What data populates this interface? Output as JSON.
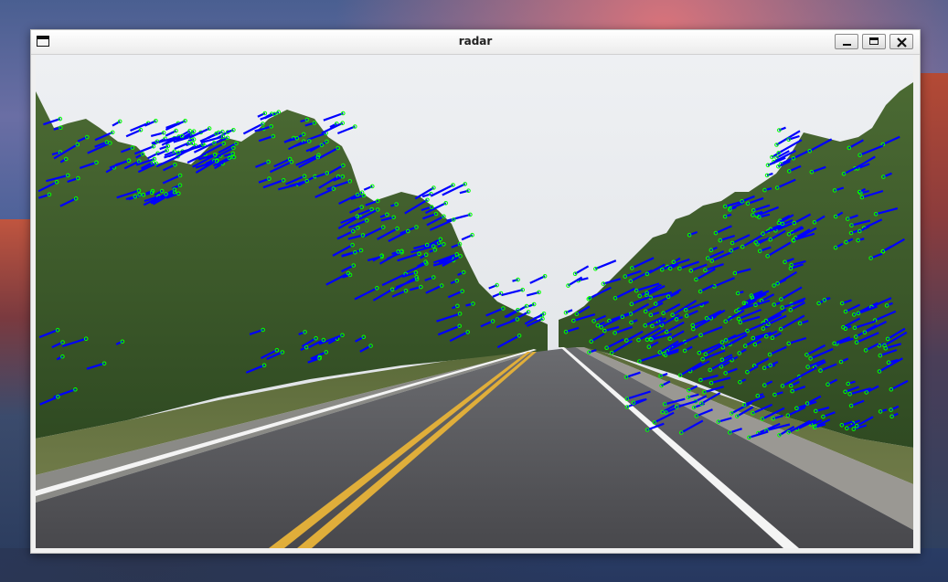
{
  "window": {
    "title": "radar",
    "buttons": {
      "minimize": "minimize",
      "maximize": "maximize",
      "close": "close"
    }
  },
  "overlay": {
    "marker_color": "#00ff00",
    "vector_color": "#0000ff"
  },
  "scene": {
    "sky_color": "#e8eaed",
    "road_color": "#4b4b4f",
    "centerline_color": "#e0ae3a",
    "edge_line_color": "#ffffff",
    "tree_color": "#3e5a2b"
  }
}
